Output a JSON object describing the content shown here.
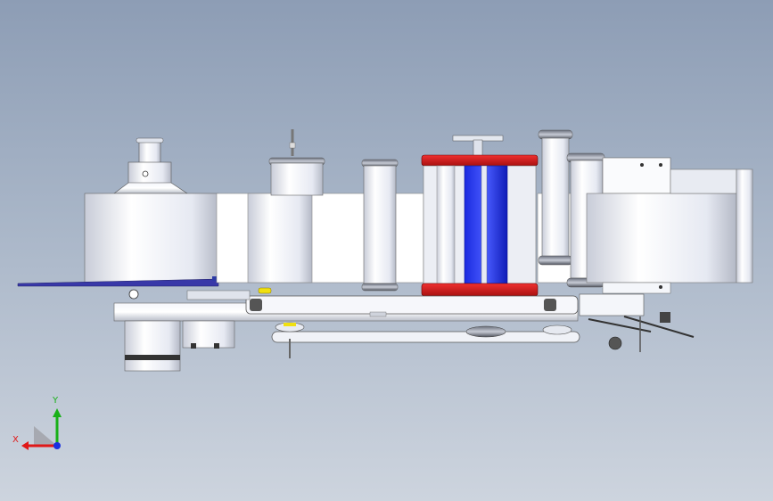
{
  "viewport": {
    "background_top": "#8d9db5",
    "background_bottom": "#cdd4de"
  },
  "model": {
    "accent_red": "#d01818",
    "accent_blue": "#1020d8",
    "label_disc_blue": "#3838a8",
    "sensor_yellow": "#f0e010"
  },
  "triad": {
    "x_label": "X",
    "y_label": "Y",
    "x_color": "#e01818",
    "y_color": "#18b018",
    "z_color": "#1830e0"
  }
}
